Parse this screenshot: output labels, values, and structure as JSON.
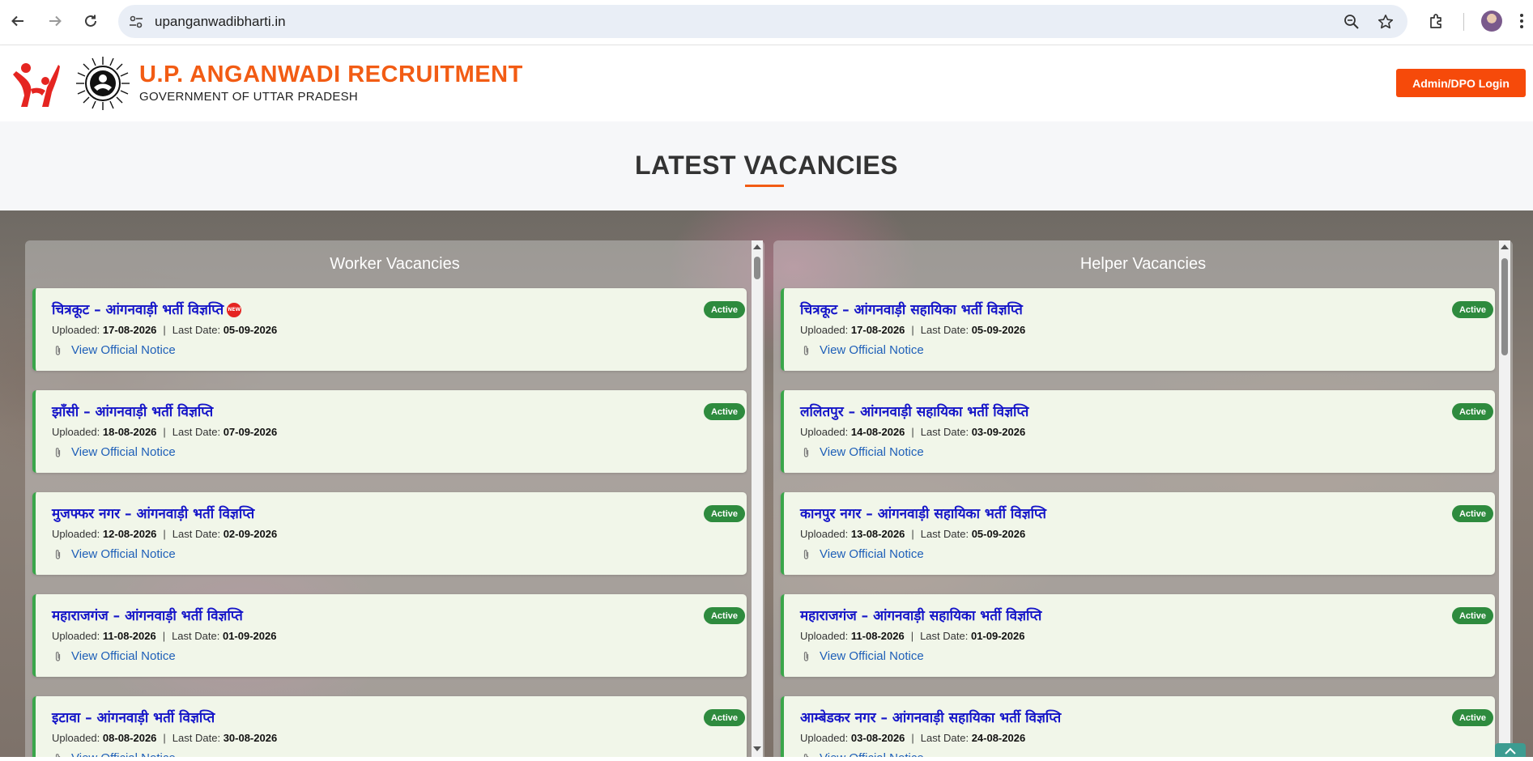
{
  "browser": {
    "url": "upanganwadibharti.in"
  },
  "header": {
    "title": "U.P. ANGANWADI RECRUITMENT",
    "subtitle": "GOVERNMENT OF UTTAR PRADESH",
    "login_label": "Admin/DPO Login"
  },
  "section": {
    "title": "LATEST VACANCIES"
  },
  "labels": {
    "uploaded": "Uploaded:",
    "last_date": "Last Date:",
    "view_notice": "View Official Notice",
    "active": "Active",
    "new_badge": "NEW"
  },
  "worker": {
    "heading": "Worker Vacancies",
    "items": [
      {
        "title": "चित्रकूट – आंगनवाड़ी भर्ती विज्ञप्ति",
        "uploaded": "17-08-2026",
        "last_date": "05-09-2026",
        "status": "Active",
        "is_new": true
      },
      {
        "title": "झाँसी – आंगनवाड़ी भर्ती विज्ञप्ति",
        "uploaded": "18-08-2026",
        "last_date": "07-09-2026",
        "status": "Active"
      },
      {
        "title": "मुजफ्फर नगर – आंगनवाड़ी भर्ती विज्ञप्ति",
        "uploaded": "12-08-2026",
        "last_date": "02-09-2026",
        "status": "Active"
      },
      {
        "title": "महाराजगंज – आंगनवाड़ी भर्ती विज्ञप्ति",
        "uploaded": "11-08-2026",
        "last_date": "01-09-2026",
        "status": "Active"
      },
      {
        "title": "इटावा – आंगनवाड़ी भर्ती विज्ञप्ति",
        "uploaded": "08-08-2026",
        "last_date": "30-08-2026",
        "status": "Active"
      }
    ]
  },
  "helper": {
    "heading": "Helper Vacancies",
    "items": [
      {
        "title": "चित्रकूट – आंगनवाड़ी सहायिका भर्ती विज्ञप्ति",
        "uploaded": "17-08-2026",
        "last_date": "05-09-2026",
        "status": "Active"
      },
      {
        "title": "ललितपुर – आंगनवाड़ी सहायिका भर्ती विज्ञप्ति",
        "uploaded": "14-08-2026",
        "last_date": "03-09-2026",
        "status": "Active"
      },
      {
        "title": "कानपुर नगर – आंगनवाड़ी सहायिका भर्ती विज्ञप्ति",
        "uploaded": "13-08-2026",
        "last_date": "05-09-2026",
        "status": "Active"
      },
      {
        "title": "महाराजगंज – आंगनवाड़ी सहायिका भर्ती विज्ञप्ति",
        "uploaded": "11-08-2026",
        "last_date": "01-09-2026",
        "status": "Active"
      },
      {
        "title": "आम्बेडकर नगर – आंगनवाड़ी सहायिका भर्ती विज्ञप्ति",
        "uploaded": "03-08-2026",
        "last_date": "24-08-2026",
        "status": "Active"
      }
    ]
  },
  "colors": {
    "brand_orange": "#f25c14",
    "login_button": "#f64a0a",
    "active_badge": "#2e8b3e",
    "card_border": "#3aa64a",
    "link_blue": "#1e5fb8",
    "title_blue": "#1515c8"
  },
  "icons": [
    "back-arrow-icon",
    "forward-arrow-icon",
    "reload-icon",
    "site-settings-icon",
    "zoom-icon",
    "bookmark-star-icon",
    "extensions-icon",
    "menu-dots-icon",
    "paperclip-icon",
    "new-badge-icon",
    "scroll-to-top-icon"
  ]
}
